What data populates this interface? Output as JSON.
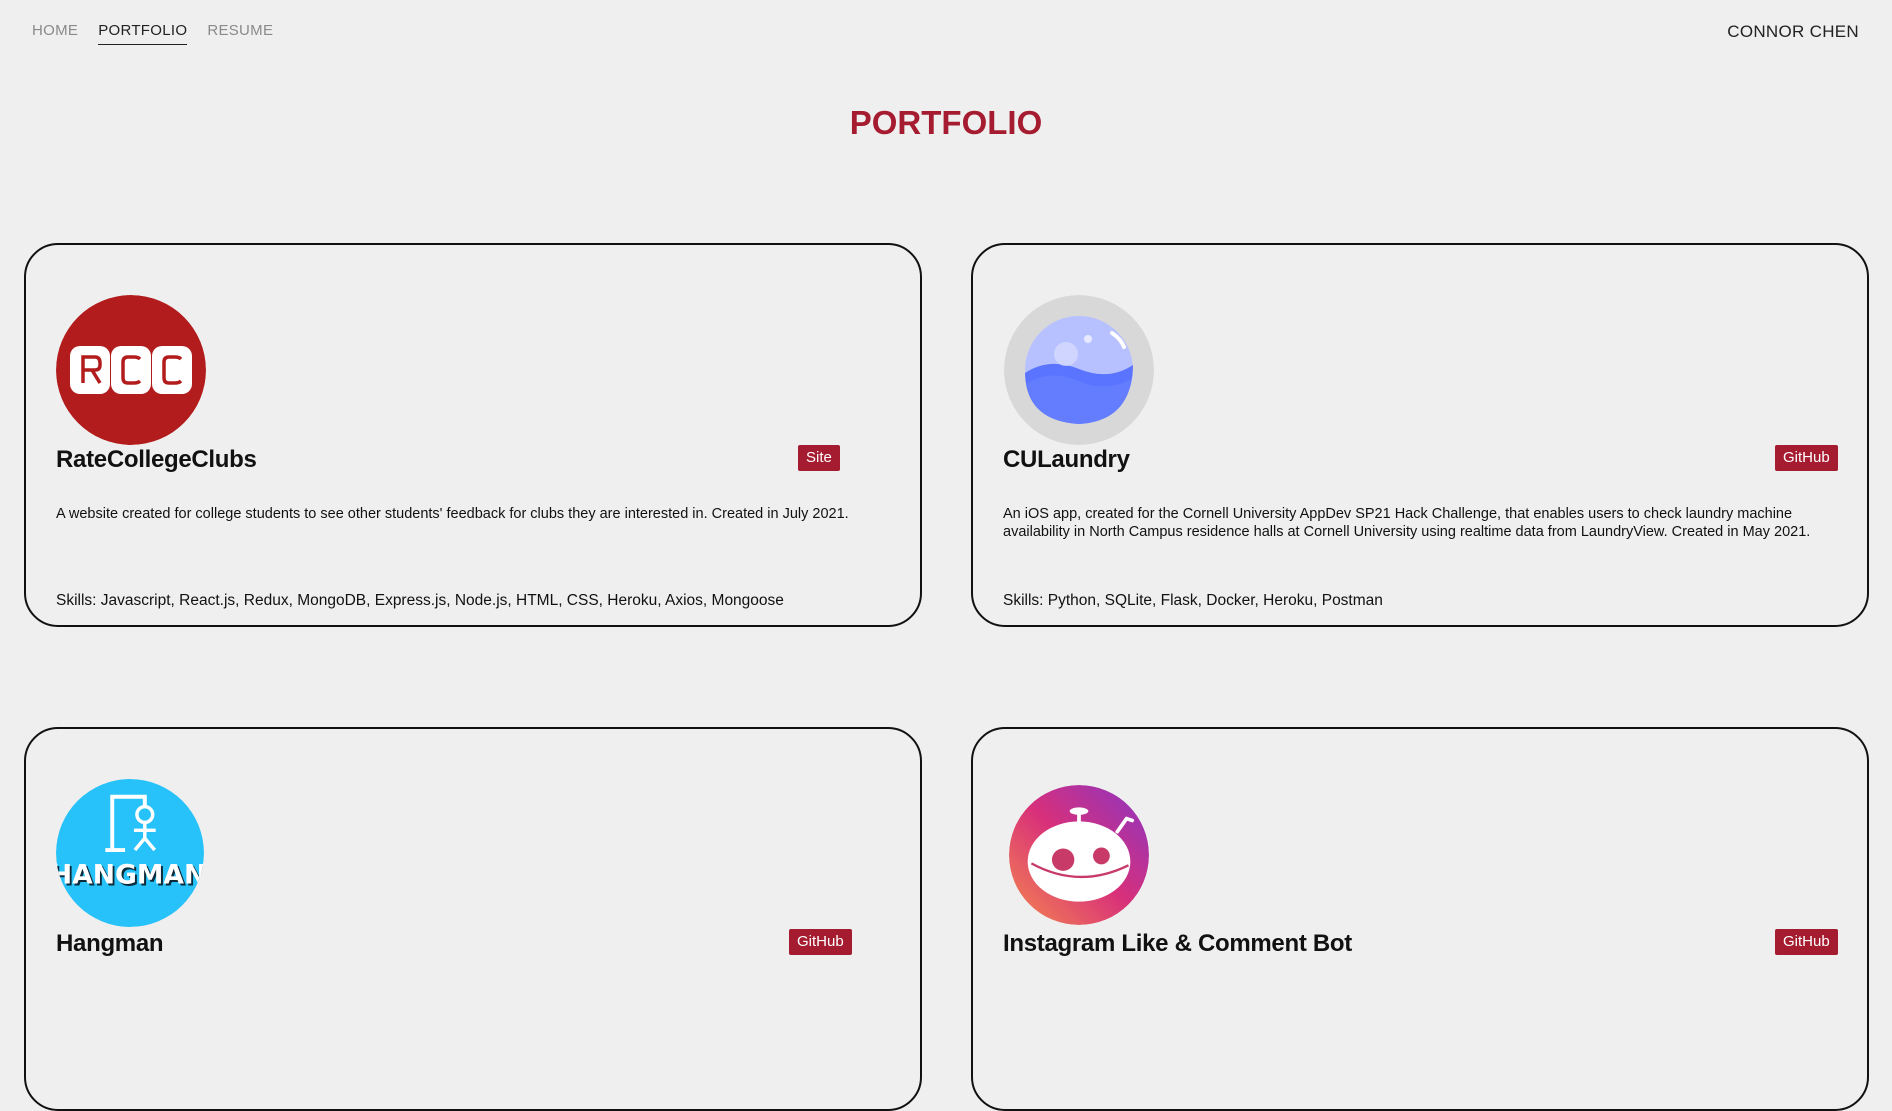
{
  "nav": {
    "links": [
      "HOME",
      "PORTFOLIO",
      "RESUME"
    ],
    "active": "PORTFOLIO",
    "brand": "CONNOR CHEN"
  },
  "page": {
    "title": "PORTFOLIO"
  },
  "colors": {
    "accent": "#a51c30",
    "background": "#efefef"
  },
  "projects": [
    {
      "title": "RateCollegeClubs",
      "button": "Site",
      "logo_icon": "rcc-logo-icon",
      "description": "A website created for college students to see other students' feedback for clubs they are interested in. Created in July 2021.",
      "skills": "Skills: Javascript, React.js, Redux, MongoDB, Express.js, Node.js, HTML, CSS, Heroku, Axios, Mongoose"
    },
    {
      "title": "CULaundry",
      "button": "GitHub",
      "logo_icon": "water-sphere-icon",
      "description": "An iOS app, created for the Cornell University AppDev SP21 Hack Challenge, that enables users to check laundry machine availability in North Campus residence halls at Cornell University using realtime data from LaundryView. Created in May 2021.",
      "skills": "Skills: Python, SQLite, Flask, Docker, Heroku, Postman"
    },
    {
      "title": "Hangman",
      "button": "GitHub",
      "logo_icon": "hangman-logo-icon",
      "logo_text": "HANGMAN",
      "description": "",
      "skills": ""
    },
    {
      "title": "Instagram Like & Comment Bot",
      "button": "GitHub",
      "logo_icon": "robot-icon",
      "description": "",
      "skills": ""
    }
  ]
}
